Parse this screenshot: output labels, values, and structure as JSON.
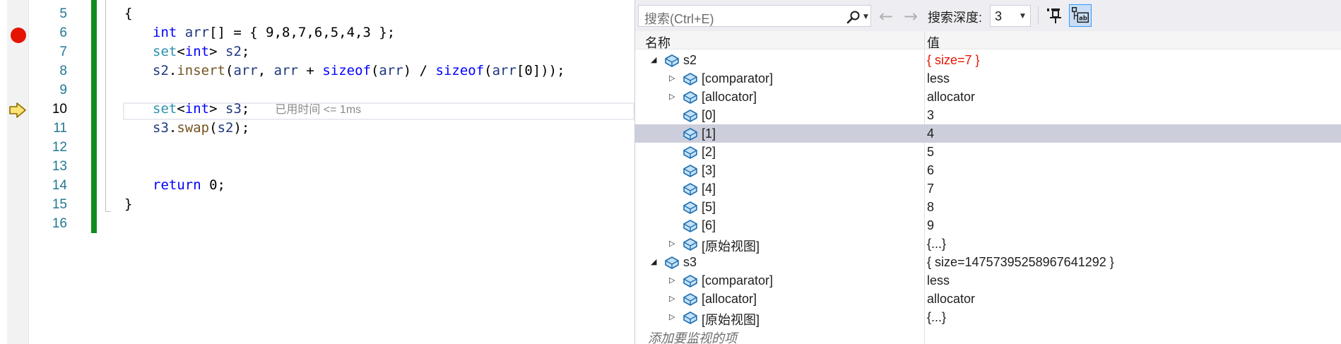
{
  "editor": {
    "lines": [
      {
        "number": "5",
        "tokens": [
          {
            "t": "{",
            "c": ""
          }
        ]
      },
      {
        "number": "6",
        "tokens": [
          {
            "t": "int",
            "c": "kw"
          },
          {
            "t": " ",
            "c": ""
          },
          {
            "t": "arr",
            "c": "id"
          },
          {
            "t": "[] = { 9,8,7,6,5,4,3 };",
            "c": ""
          }
        ]
      },
      {
        "number": "7",
        "tokens": [
          {
            "t": "set",
            "c": "tp"
          },
          {
            "t": "<",
            "c": ""
          },
          {
            "t": "int",
            "c": "kw"
          },
          {
            "t": "> ",
            "c": ""
          },
          {
            "t": "s2",
            "c": "id"
          },
          {
            "t": ";",
            "c": ""
          }
        ]
      },
      {
        "number": "8",
        "tokens": [
          {
            "t": "s2",
            "c": "id"
          },
          {
            "t": ".",
            "c": ""
          },
          {
            "t": "insert",
            "c": "fn"
          },
          {
            "t": "(",
            "c": ""
          },
          {
            "t": "arr",
            "c": "id"
          },
          {
            "t": ", ",
            "c": ""
          },
          {
            "t": "arr",
            "c": "id"
          },
          {
            "t": " + ",
            "c": ""
          },
          {
            "t": "sizeof",
            "c": "kw"
          },
          {
            "t": "(",
            "c": ""
          },
          {
            "t": "arr",
            "c": "id"
          },
          {
            "t": ") / ",
            "c": ""
          },
          {
            "t": "sizeof",
            "c": "kw"
          },
          {
            "t": "(",
            "c": ""
          },
          {
            "t": "arr",
            "c": "id"
          },
          {
            "t": "[0]));",
            "c": ""
          }
        ]
      },
      {
        "number": "9",
        "tokens": []
      },
      {
        "number": "10",
        "tokens": [
          {
            "t": "set",
            "c": "tp"
          },
          {
            "t": "<",
            "c": ""
          },
          {
            "t": "int",
            "c": "kw"
          },
          {
            "t": "> ",
            "c": ""
          },
          {
            "t": "s3",
            "c": "id"
          },
          {
            "t": ";",
            "c": ""
          }
        ],
        "hint": "已用时间 <= 1ms",
        "current": true
      },
      {
        "number": "11",
        "tokens": [
          {
            "t": "s3",
            "c": "id"
          },
          {
            "t": ".",
            "c": ""
          },
          {
            "t": "swap",
            "c": "fn"
          },
          {
            "t": "(",
            "c": ""
          },
          {
            "t": "s2",
            "c": "id"
          },
          {
            "t": ");",
            "c": ""
          }
        ]
      },
      {
        "number": "12",
        "tokens": []
      },
      {
        "number": "13",
        "tokens": []
      },
      {
        "number": "14",
        "tokens": [
          {
            "t": "return",
            "c": "kw"
          },
          {
            "t": " 0;",
            "c": ""
          }
        ]
      },
      {
        "number": "15",
        "tokens": [
          {
            "t": "}",
            "c": ""
          }
        ]
      },
      {
        "number": "16",
        "tokens": []
      }
    ]
  },
  "watch": {
    "search_placeholder": "搜索(Ctrl+E)",
    "search_depth_label": "搜索深度:",
    "search_depth_value": "3",
    "columns": {
      "name": "名称",
      "value": "值"
    },
    "rows": [
      {
        "level": 0,
        "expander": "open",
        "name": "s2",
        "value": "{ size=7 }",
        "changed": true
      },
      {
        "level": 1,
        "expander": "closed",
        "name": "[comparator]",
        "value": "less"
      },
      {
        "level": 1,
        "expander": "closed",
        "name": "[allocator]",
        "value": "allocator"
      },
      {
        "level": 1,
        "expander": "none",
        "name": "[0]",
        "value": "3"
      },
      {
        "level": 1,
        "expander": "none",
        "name": "[1]",
        "value": "4",
        "selected": true
      },
      {
        "level": 1,
        "expander": "none",
        "name": "[2]",
        "value": "5"
      },
      {
        "level": 1,
        "expander": "none",
        "name": "[3]",
        "value": "6"
      },
      {
        "level": 1,
        "expander": "none",
        "name": "[4]",
        "value": "7"
      },
      {
        "level": 1,
        "expander": "none",
        "name": "[5]",
        "value": "8"
      },
      {
        "level": 1,
        "expander": "none",
        "name": "[6]",
        "value": "9"
      },
      {
        "level": 1,
        "expander": "closed",
        "name": "[原始视图]",
        "value": "{...}"
      },
      {
        "level": 0,
        "expander": "open",
        "name": "s3",
        "value": "{ size=14757395258967641292 }"
      },
      {
        "level": 1,
        "expander": "closed",
        "name": "[comparator]",
        "value": "less"
      },
      {
        "level": 1,
        "expander": "closed",
        "name": "[allocator]",
        "value": "allocator"
      },
      {
        "level": 1,
        "expander": "closed",
        "name": "[原始视图]",
        "value": "{...}"
      }
    ],
    "add_item_label": "添加要监视的项"
  }
}
